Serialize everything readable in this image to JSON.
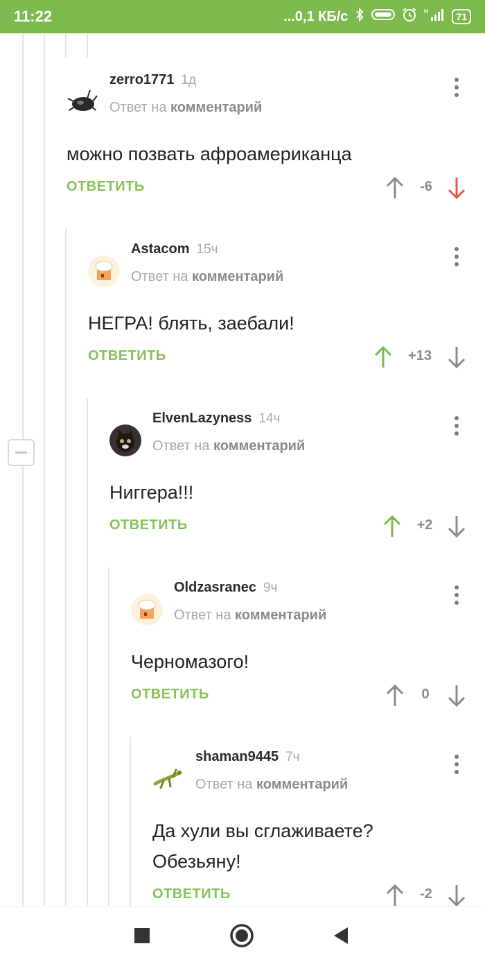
{
  "status_bar": {
    "time": "11:22",
    "speed": "...0,1 КБ/с",
    "battery": "71",
    "icons": [
      "bluetooth-icon",
      "vpn-icon",
      "alarm-icon",
      "signal-icon",
      "battery-icon"
    ]
  },
  "labels": {
    "reply_to_prefix": "Ответ на",
    "reply_to_target": "комментарий",
    "reply_button": "ОТВЕТИТЬ"
  },
  "colors": {
    "accent_green": "#86c15a",
    "status_bar": "#7dba4e",
    "downvote_red": "#e25a3f",
    "neutral_grey": "#8a8a8a"
  },
  "comments": [
    {
      "user": "zerro1771",
      "time": "1д",
      "text": "можно позвать афроамериканца",
      "rating": "-6",
      "vote": "down",
      "avatar": "beetle-avatar"
    },
    {
      "user": "Astacom",
      "time": "15ч",
      "text": "НЕГРА! блять, заебали!",
      "rating": "+13",
      "vote": "up",
      "avatar": "default-avatar"
    },
    {
      "user": "ElvenLazyness",
      "time": "14ч",
      "text": "Ниггера!!!",
      "rating": "+2",
      "vote": "up",
      "avatar": "cat-avatar"
    },
    {
      "user": "Oldzasranec",
      "time": "9ч",
      "text": "Черномазого!",
      "rating": "0",
      "vote": "none",
      "avatar": "default-avatar"
    },
    {
      "user": "shaman9445",
      "time": "7ч",
      "text_lines": [
        "Да хули вы сглаживаете?",
        "Обезьяну!"
      ],
      "rating": "-2",
      "vote": "none",
      "avatar": "lizard-avatar"
    }
  ],
  "nav": [
    "recents-button",
    "home-button",
    "back-button"
  ]
}
